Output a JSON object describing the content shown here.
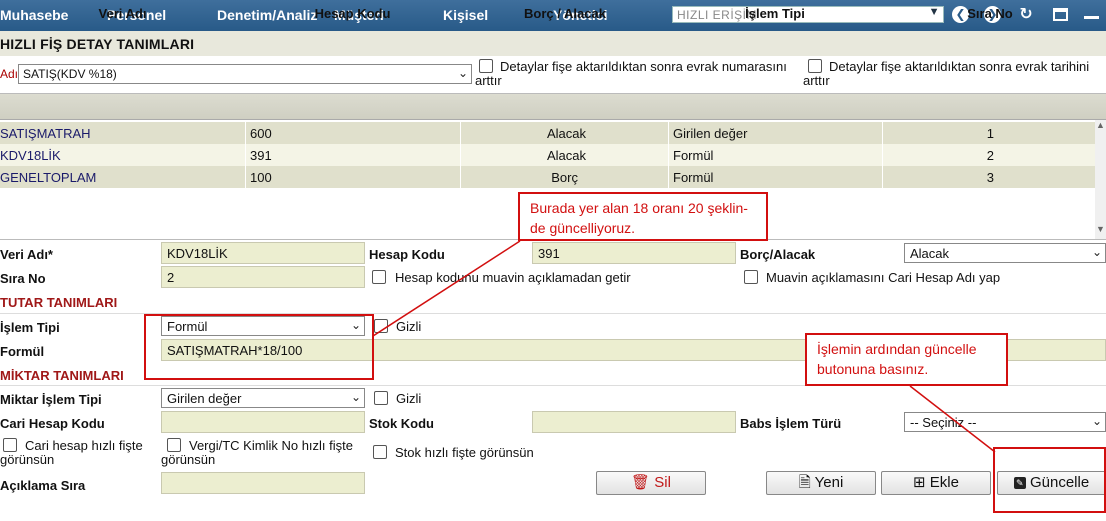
{
  "nav": {
    "items": [
      "Muhasebe",
      "Personel",
      "Denetim/Analiz",
      "Müşteri",
      "Kişisel",
      "Yönetici"
    ],
    "quick_access": "HIZLI ERİŞİM"
  },
  "page": {
    "title": "HIZLI FİŞ DETAY TANIMLARI"
  },
  "header_row": {
    "ad_label": "Adı",
    "ad_value": "SATIŞ(KDV %18)",
    "check1_label_a": "Detaylar fişe aktarıldıktan sonra evrak numarasını",
    "check1_label_b": "arttır",
    "check2_label_a": "Detaylar fişe aktarıldıktan sonra evrak tarihini",
    "check2_label_b": "arttır"
  },
  "grid": {
    "columns": [
      "Veri Adı",
      "Hesap Kodu",
      "Borç / Alacak",
      "İşlem Tipi",
      "Sıra No"
    ],
    "rows": [
      {
        "veri": "SATIŞMATRAH",
        "hesap": "600",
        "ba": "Alacak",
        "tip": "Girilen değer",
        "sira": "1"
      },
      {
        "veri": "KDV18LİK",
        "hesap": "391",
        "ba": "Alacak",
        "tip": "Formül",
        "sira": "2"
      },
      {
        "veri": "GENELTOPLAM",
        "hesap": "100",
        "ba": "Borç",
        "tip": "Formül",
        "sira": "3"
      }
    ]
  },
  "form": {
    "veri_adi_label": "Veri Adı*",
    "veri_adi_value": "KDV18LİK",
    "hesap_kodu_label": "Hesap Kodu",
    "hesap_kodu_value": "391",
    "borc_alacak_label": "Borç/Alacak",
    "borc_alacak_value": "Alacak",
    "sira_no_label": "Sıra No",
    "sira_no_value": "2",
    "hesap_muavin_label": "Hesap kodunu muavin açıklamadan getir",
    "muavin_cari_label": "Muavin açıklamasını Cari Hesap Adı yap",
    "tutar_section": "TUTAR TANIMLARI",
    "islem_tipi_label": "İşlem Tipi",
    "islem_tipi_value": "Formül",
    "gizli1_label": "Gizli",
    "formul_label": "Formül",
    "formul_value": "SATIŞMATRAH*18/100",
    "miktar_section": "MİKTAR TANIMLARI",
    "miktar_islem_label": "Miktar İşlem Tipi",
    "miktar_islem_value": "Girilen değer",
    "gizli2_label": "Gizli",
    "cari_hesap_label": "Cari Hesap Kodu",
    "stok_kodu_label": "Stok Kodu",
    "babs_label": "Babs İşlem Türü",
    "babs_value": "-- Seçiniz --",
    "cari_hizli_a": "Cari hesap hızlı fişte",
    "cari_hizli_b": "görünsün",
    "vergi_hizli_a": "Vergi/TC Kimlik No hızlı fişte",
    "vergi_hizli_b": "görünsün",
    "stok_hizli": "Stok hızlı fişte görünsün",
    "aciklama_label": "Açıklama Sıra"
  },
  "buttons": {
    "sil": "Sil",
    "yeni": "Yeni",
    "ekle": "Ekle",
    "guncelle": "Güncelle"
  },
  "annotations": {
    "callout1_a": "Burada yer alan 18 oranı 20 şeklin-",
    "callout1_b": "de güncelliyoruz.",
    "callout2_a": "İşlemin ardından güncelle",
    "callout2_b": "butonuna basınız."
  },
  "colors": {
    "nav": "#2b5b88",
    "field": "#eceed0",
    "annotation": "#d20f0f",
    "section": "#a01818"
  }
}
